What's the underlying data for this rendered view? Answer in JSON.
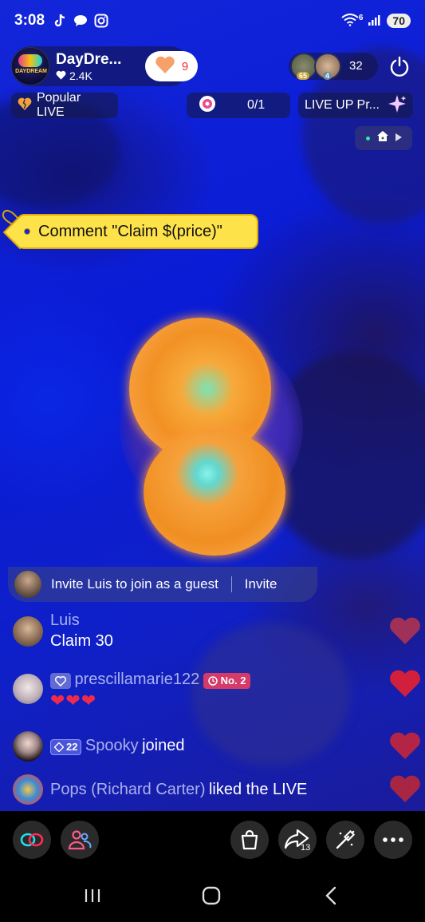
{
  "status": {
    "time": "3:08",
    "battery": "70",
    "wifi_label": "6"
  },
  "host": {
    "name": "DayDre...",
    "likes": "2.4K",
    "logo_text": "DAYDREAM",
    "follow_count": "9"
  },
  "viewers": {
    "count": "32",
    "badge1": "65",
    "badge2": "4"
  },
  "chips": {
    "popular": "Popular LIVE",
    "gifts": "0/1",
    "liveup": "LIVE UP Pr..."
  },
  "tag": {
    "text": "Comment \"Claim $(price)\""
  },
  "invite": {
    "text": "Invite Luis to join as a guest",
    "button": "Invite"
  },
  "chat": [
    {
      "user": "Luis",
      "text": "Claim 30"
    },
    {
      "user": "prescillamarie122",
      "badge": "No. 2",
      "text": "❤❤❤"
    },
    {
      "user": "Spooky",
      "level": "22",
      "text": "joined"
    },
    {
      "user": "Pops (Richard Carter)",
      "text": "liked the LIVE"
    }
  ],
  "bottom": {
    "share_count": "13"
  },
  "colors": {
    "accent": "#fe2c55",
    "tag": "#fde24a",
    "stage": "#1326d8"
  }
}
